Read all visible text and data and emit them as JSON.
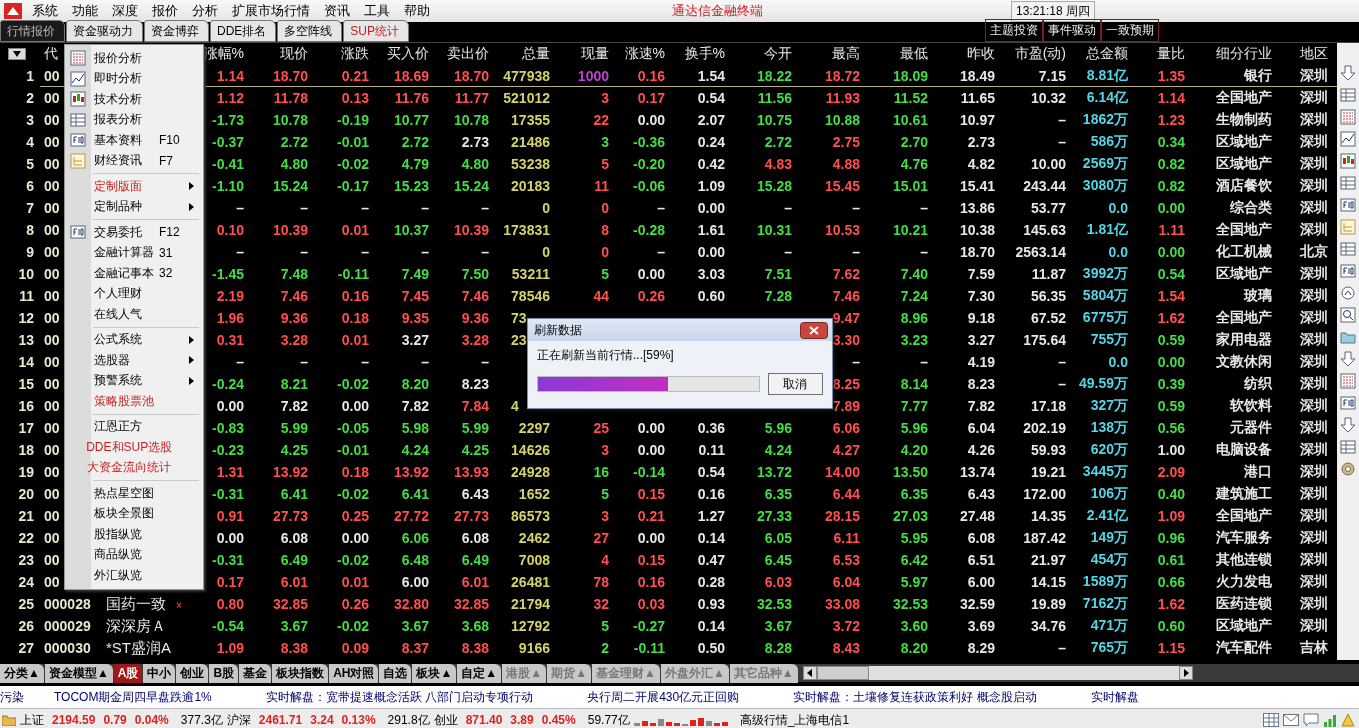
{
  "menu_bar": {
    "items": [
      "系统",
      "功能",
      "深度",
      "报价",
      "分析",
      "扩展市场行情",
      "资讯",
      "工具",
      "帮助"
    ],
    "title": "通达信金融终端",
    "clock": "13:21:18 周四"
  },
  "tabs": [
    {
      "label": "行情报价",
      "selected": true,
      "highlight": false
    },
    {
      "label": "资金驱动力",
      "selected": false,
      "highlight": false
    },
    {
      "label": "资金博弈",
      "selected": false,
      "highlight": false
    },
    {
      "label": "DDE排名",
      "selected": false,
      "highlight": false
    },
    {
      "label": "多空阵线",
      "selected": false,
      "highlight": false
    },
    {
      "label": "SUP统计",
      "selected": false,
      "highlight": true
    }
  ],
  "quick_buttons": [
    "主题投资",
    "事件驱动",
    "一致预期"
  ],
  "table": {
    "columns": [
      {
        "kind": "index"
      },
      {
        "label": "代",
        "kind": "code"
      },
      {
        "kind": "name"
      },
      {
        "label": "涨幅%",
        "kind": "sign"
      },
      {
        "label": "现价",
        "kind": "price"
      },
      {
        "label": "涨跌",
        "kind": "sign"
      },
      {
        "label": "买入价",
        "kind": "price"
      },
      {
        "label": "卖出价",
        "kind": "price"
      },
      {
        "label": "总量",
        "kind": "volume"
      },
      {
        "label": "现量",
        "kind": "tick"
      },
      {
        "label": "涨速%",
        "kind": "sign"
      },
      {
        "label": "换手%",
        "kind": "plain"
      },
      {
        "label": "今开",
        "kind": "price"
      },
      {
        "label": "最高",
        "kind": "price"
      },
      {
        "label": "最低",
        "kind": "price"
      },
      {
        "label": "昨收",
        "kind": "prev"
      },
      {
        "label": "市盈(动)",
        "kind": "plain"
      },
      {
        "label": "总金额",
        "kind": "amount"
      },
      {
        "label": "量比",
        "kind": "ratio"
      },
      {
        "label": "细分行业",
        "kind": "text"
      },
      {
        "label": "地区",
        "kind": "text"
      }
    ],
    "rows": [
      {
        "selected": true,
        "color": "#c040d0",
        "cells": [
          "1",
          "00",
          null,
          "1.14",
          "18.70",
          "0.21",
          "18.69",
          "18.70",
          "477938",
          "1000",
          "0.16",
          "1.54",
          "18.22",
          "18.72",
          "18.09",
          "18.49",
          "7.15",
          "8.81亿",
          "1.35",
          "银行",
          "深圳"
        ]
      },
      {
        "selected": false,
        "color": "#ff4f4f",
        "cells": [
          "2",
          "00",
          null,
          "1.12",
          "11.78",
          "0.13",
          "11.76",
          "11.77",
          "521012",
          "3",
          "0.17",
          "0.54",
          "11.56",
          "11.93",
          "11.52",
          "11.65",
          "10.32",
          "6.14亿",
          "1.14",
          "全国地产",
          "深圳"
        ]
      },
      {
        "selected": false,
        "color": "#ff4f4f",
        "cells": [
          "3",
          "00",
          null,
          "-1.73",
          "10.78",
          "-0.19",
          "10.77",
          "10.78",
          "17355",
          "22",
          "0.00",
          "2.07",
          "10.75",
          "10.88",
          "10.61",
          "10.97",
          "–",
          "1862万",
          "1.23",
          "生物制药",
          "深圳"
        ]
      },
      {
        "selected": false,
        "color": "#45dd45",
        "cells": [
          "4",
          "00",
          null,
          "-0.37",
          "2.72",
          "-0.01",
          "2.72",
          "2.73",
          "21486",
          "3",
          "-0.36",
          "0.24",
          "2.72",
          "2.75",
          "2.70",
          "2.73",
          "–",
          "586万",
          "0.34",
          "区域地产",
          "深圳"
        ]
      },
      {
        "selected": false,
        "color": "#ff4f4f",
        "cells": [
          "5",
          "00",
          null,
          "-0.41",
          "4.80",
          "-0.02",
          "4.79",
          "4.80",
          "53238",
          "5",
          "-0.20",
          "0.42",
          "4.83",
          "4.88",
          "4.76",
          "4.82",
          "10.00",
          "2569万",
          "0.82",
          "区域地产",
          "深圳"
        ]
      },
      {
        "selected": false,
        "color": "#ff4f4f",
        "cells": [
          "6",
          "00",
          null,
          "-1.10",
          "15.24",
          "-0.17",
          "15.23",
          "15.24",
          "20183",
          "11",
          "-0.06",
          "1.09",
          "15.28",
          "15.45",
          "15.01",
          "15.41",
          "243.44",
          "3080万",
          "0.82",
          "酒店餐饮",
          "深圳"
        ]
      },
      {
        "selected": false,
        "color": "#ff4f4f",
        "cells": [
          "7",
          "00",
          null,
          "–",
          "–",
          "–",
          "–",
          "–",
          "0",
          "0",
          "–",
          "0.00",
          "–",
          "–",
          "–",
          "13.86",
          "53.77",
          "0.0",
          "0.00",
          "综合类",
          "深圳"
        ]
      },
      {
        "selected": false,
        "color": "#ff4f4f",
        "cells": [
          "8",
          "00",
          null,
          "0.10",
          "10.39",
          "0.01",
          "10.37",
          "10.39",
          "173831",
          "8",
          "-0.28",
          "1.61",
          "10.31",
          "10.53",
          "10.21",
          "10.38",
          "145.63",
          "1.81亿",
          "1.11",
          "全国地产",
          "深圳"
        ]
      },
      {
        "selected": false,
        "color": "#ff4f4f",
        "cells": [
          "9",
          "00",
          null,
          "–",
          "–",
          "–",
          "–",
          "–",
          "0",
          "0",
          "–",
          "0.00",
          "–",
          "–",
          "–",
          "18.70",
          "2563.14",
          "0.0",
          "0.00",
          "化工机械",
          "北京"
        ]
      },
      {
        "selected": false,
        "color": "#45dd45",
        "cells": [
          "10",
          "00",
          null,
          "-1.45",
          "7.48",
          "-0.11",
          "7.49",
          "7.50",
          "53211",
          "5",
          "0.00",
          "3.03",
          "7.51",
          "7.62",
          "7.40",
          "7.59",
          "11.87",
          "3992万",
          "0.54",
          "区域地产",
          "深圳"
        ]
      },
      {
        "selected": false,
        "color": "#ff4f4f",
        "cells": [
          "11",
          "00",
          null,
          "2.19",
          "7.46",
          "0.16",
          "7.45",
          "7.46",
          "78546",
          "44",
          "0.26",
          "0.60",
          "7.28",
          "7.46",
          "7.24",
          "7.30",
          "56.35",
          "5804万",
          "1.54",
          "玻璃",
          "深圳"
        ]
      },
      {
        "selected": false,
        "cells": [
          "12",
          "00",
          null,
          "1.96",
          "9.36",
          "0.18",
          "9.35",
          "9.36",
          {
            "text": "73",
            "kind": "clipped"
          },
          null,
          null,
          null,
          null,
          "9.47",
          "8.96",
          "9.18",
          "67.52",
          "6775万",
          "1.62",
          "全国地产",
          "深圳"
        ]
      },
      {
        "selected": false,
        "cells": [
          "13",
          "00",
          null,
          "0.31",
          "3.28",
          "0.01",
          "3.27",
          "3.28",
          {
            "text": "23",
            "kind": "clipped"
          },
          null,
          null,
          null,
          null,
          "3.30",
          "3.23",
          "3.27",
          "175.64",
          "755万",
          "0.59",
          "家用电器",
          "深圳"
        ]
      },
      {
        "selected": false,
        "cells": [
          "14",
          "00",
          null,
          "–",
          "–",
          "–",
          "–",
          "–",
          null,
          null,
          null,
          null,
          null,
          "–",
          "–",
          "4.19",
          "–",
          "0.0",
          "0.00",
          "文教休闲",
          "深圳"
        ]
      },
      {
        "selected": false,
        "cells": [
          "15",
          "00",
          null,
          "-0.24",
          "8.21",
          "-0.02",
          "8.20",
          "8.23",
          null,
          null,
          null,
          null,
          null,
          "8.25",
          "8.14",
          "8.23",
          "–",
          "49.59万",
          "0.39",
          "纺织",
          "深圳"
        ]
      },
      {
        "selected": false,
        "cells": [
          "16",
          "00",
          null,
          "0.00",
          "7.82",
          "0.00",
          "7.82",
          "7.84",
          {
            "text": "4",
            "kind": "clipped"
          },
          null,
          null,
          null,
          null,
          "7.89",
          "7.77",
          "7.82",
          "17.18",
          "327万",
          "0.59",
          "软饮料",
          "深圳"
        ]
      },
      {
        "selected": false,
        "color": "#ff4f4f",
        "cells": [
          "17",
          "00",
          null,
          "-0.83",
          "5.99",
          "-0.05",
          "5.98",
          "5.99",
          "2297",
          "25",
          "0.00",
          "0.36",
          "5.96",
          "6.06",
          "5.96",
          "6.04",
          "202.19",
          "138万",
          "0.56",
          "元器件",
          "深圳"
        ]
      },
      {
        "selected": false,
        "color": "#ff4f4f",
        "cells": [
          "18",
          "00",
          null,
          "-0.23",
          "4.25",
          "-0.01",
          "4.24",
          "4.25",
          "14626",
          "3",
          "0.00",
          "0.11",
          "4.24",
          "4.27",
          "4.20",
          "4.26",
          "59.93",
          "620万",
          "1.00",
          "电脑设备",
          "深圳"
        ]
      },
      {
        "selected": false,
        "color": "#45dd45",
        "cells": [
          "19",
          "00",
          null,
          "1.31",
          "13.92",
          "0.18",
          "13.92",
          "13.93",
          "24928",
          "16",
          "-0.14",
          "0.54",
          "13.72",
          "14.00",
          "13.50",
          "13.74",
          "19.21",
          "3445万",
          "2.09",
          "港口",
          "深圳"
        ]
      },
      {
        "selected": false,
        "color": "#45dd45",
        "cells": [
          "20",
          "00",
          null,
          "-0.31",
          "6.41",
          "-0.02",
          "6.41",
          "6.43",
          "1652",
          "5",
          "0.15",
          "0.16",
          "6.35",
          "6.44",
          "6.35",
          "6.43",
          "172.00",
          "106万",
          "0.40",
          "建筑施工",
          "深圳"
        ]
      },
      {
        "selected": false,
        "color": "#ff4f4f",
        "cells": [
          "21",
          "00",
          null,
          "0.91",
          "27.73",
          "0.25",
          "27.72",
          "27.73",
          "86573",
          "3",
          "0.21",
          "1.27",
          "27.33",
          "28.15",
          "27.03",
          "27.48",
          "14.35",
          "2.41亿",
          "1.09",
          "全国地产",
          "深圳"
        ]
      },
      {
        "selected": false,
        "color": "#ff4f4f",
        "cells": [
          "22",
          "00",
          null,
          "0.00",
          "6.08",
          "0.00",
          "6.06",
          "6.08",
          "2462",
          "27",
          "0.00",
          "0.14",
          "6.05",
          "6.11",
          "5.95",
          "6.08",
          "187.42",
          "149万",
          "0.96",
          "汽车服务",
          "深圳"
        ]
      },
      {
        "selected": false,
        "color": "#ff4f4f",
        "cells": [
          "23",
          "00",
          null,
          "-0.31",
          "6.49",
          "-0.02",
          "6.48",
          "6.49",
          "7008",
          "4",
          "0.15",
          "0.47",
          "6.45",
          "6.53",
          "6.42",
          "6.51",
          "21.97",
          "454万",
          "0.61",
          "其他连锁",
          "深圳"
        ]
      },
      {
        "selected": false,
        "color": "#ff4f4f",
        "cells": [
          "24",
          "00",
          null,
          "0.17",
          "6.01",
          "0.01",
          "6.00",
          "6.01",
          "26481",
          "78",
          "0.16",
          "0.28",
          "6.03",
          "6.04",
          "5.97",
          "6.00",
          "14.15",
          "1589万",
          "0.66",
          "火力发电",
          "深圳"
        ]
      },
      {
        "selected": false,
        "color": "#ff4f4f",
        "flag": "×",
        "cells": [
          "25",
          "000028",
          "国药一致",
          "0.80",
          "32.85",
          "0.26",
          "32.80",
          "32.85",
          "21794",
          "32",
          "0.03",
          "0.93",
          "32.53",
          "33.08",
          "32.53",
          "32.59",
          "19.89",
          "7162万",
          "1.62",
          "医药连锁",
          "深圳"
        ]
      },
      {
        "selected": false,
        "color": "#45dd45",
        "cells": [
          "26",
          "000029",
          "深深房Ａ",
          "-0.54",
          "3.67",
          "-0.02",
          "3.67",
          "3.68",
          "12792",
          "5",
          "-0.27",
          "0.14",
          "3.67",
          "3.72",
          "3.60",
          "3.69",
          "34.76",
          "471万",
          "0.60",
          "区域地产",
          "深圳"
        ]
      },
      {
        "selected": false,
        "color": "#45dd45",
        "cells": [
          "27",
          "000030",
          "*ST盛润A",
          "1.09",
          "8.38",
          "0.09",
          "8.37",
          "8.38",
          "9166",
          "2",
          "-0.11",
          "0.50",
          "8.28",
          "8.43",
          "8.20",
          "8.29",
          "–",
          "765万",
          "1.15",
          "汽车配件",
          "吉林"
        ]
      }
    ]
  },
  "context_menu": {
    "groups": [
      [
        {
          "label": "报价分析",
          "kind": "grid",
          "submenu": false,
          "highlight": false
        },
        {
          "label": "即时分析",
          "kind": "line",
          "submenu": false,
          "highlight": false
        },
        {
          "label": "技术分析",
          "kind": "candle",
          "submenu": false,
          "highlight": false
        },
        {
          "label": "报表分析",
          "kind": "table",
          "submenu": false,
          "highlight": false
        },
        {
          "label": "基本资料",
          "shortcut": "F10",
          "kind": "key",
          "submenu": false,
          "highlight": false
        },
        {
          "label": "财经资讯",
          "shortcut": "F7",
          "kind": "tree",
          "submenu": false,
          "highlight": false
        }
      ],
      [
        {
          "label": "定制版面",
          "submenu": true,
          "highlight": true
        },
        {
          "label": "定制品种",
          "submenu": true,
          "highlight": false
        }
      ],
      [
        {
          "label": "交易委托",
          "shortcut": "F12",
          "kind": "key",
          "submenu": false,
          "highlight": false
        },
        {
          "label": "金融计算器",
          "shortcut": "31",
          "submenu": false,
          "highlight": false
        },
        {
          "label": "金融记事本",
          "shortcut": "32",
          "submenu": false,
          "highlight": false
        },
        {
          "label": "个人理财",
          "submenu": false,
          "highlight": false
        },
        {
          "label": "在线人气",
          "submenu": false,
          "highlight": false
        }
      ],
      [
        {
          "label": "公式系统",
          "submenu": true,
          "highlight": false
        },
        {
          "label": "选股器",
          "submenu": true,
          "highlight": false
        },
        {
          "label": "预警系统",
          "submenu": true,
          "highlight": false
        },
        {
          "label": "策略股票池",
          "submenu": false,
          "highlight": true
        }
      ],
      [
        {
          "label": "江恩正方",
          "submenu": false,
          "highlight": false
        },
        {
          "label": "DDE和SUP选股",
          "submenu": false,
          "highlight": true
        },
        {
          "label": "大资金流向统计",
          "submenu": false,
          "highlight": true
        }
      ],
      [
        {
          "label": "热点星空图",
          "submenu": false,
          "highlight": false
        },
        {
          "label": "板块全景图",
          "submenu": false,
          "highlight": false
        },
        {
          "label": "股指纵览",
          "submenu": false,
          "highlight": false
        },
        {
          "label": "商品纵览",
          "submenu": false,
          "highlight": false
        },
        {
          "label": "外汇纵览",
          "submenu": false,
          "highlight": false
        }
      ]
    ]
  },
  "dialog": {
    "title": "刷新数据",
    "message": "正在刷新当前行情...[59%]",
    "level": 0.59,
    "button": "取消"
  },
  "market_tabs": [
    {
      "label": "分类▲",
      "selected": false,
      "dim": false
    },
    {
      "label": "资金模型▲",
      "selected": false,
      "dim": false
    },
    {
      "label": "A股",
      "selected": true,
      "dim": false
    },
    {
      "label": "中小",
      "selected": false,
      "dim": false
    },
    {
      "label": "创业",
      "selected": false,
      "dim": false
    },
    {
      "label": "B股",
      "selected": false,
      "dim": false
    },
    {
      "label": "基金",
      "selected": false,
      "dim": false
    },
    {
      "label": "板块指数",
      "selected": false,
      "dim": false
    },
    {
      "label": "AH对照",
      "selected": false,
      "dim": false
    },
    {
      "label": "自选",
      "selected": false,
      "dim": false
    },
    {
      "label": "板块▲",
      "selected": false,
      "dim": false
    },
    {
      "label": "自定▲",
      "selected": false,
      "dim": false
    },
    {
      "label": "港股▲",
      "selected": false,
      "dim": true
    },
    {
      "label": "期货▲",
      "selected": false,
      "dim": true
    },
    {
      "label": "基金理财▲",
      "selected": false,
      "dim": true
    },
    {
      "label": "外盘外汇▲",
      "selected": false,
      "dim": true
    },
    {
      "label": "其它品种▲",
      "selected": false,
      "dim": true
    }
  ],
  "news_ticker": [
    "污染",
    "TOCOM期金周四早盘跌逾1%",
    "实时解盘：宽带提速概念活跃 八部门启动专项行动",
    "央行周二开展430亿元正回购",
    "实时解盘：土壤修复连获政策利好 概念股启动",
    "实时解盘"
  ],
  "status_bar": {
    "indices": [
      {
        "name": "上证",
        "value": "2194.59",
        "change": "0.79",
        "pct": "0.04%",
        "amount": "377.3亿"
      },
      {
        "name": "沪深",
        "value": "2461.71",
        "change": "3.24",
        "pct": "0.13%",
        "amount": "291.8亿"
      },
      {
        "name": "创业",
        "value": "871.40",
        "change": "3.89",
        "pct": "0.45%",
        "amount": "59.77亿"
      }
    ],
    "connection": "高级行情_上海电信1"
  }
}
